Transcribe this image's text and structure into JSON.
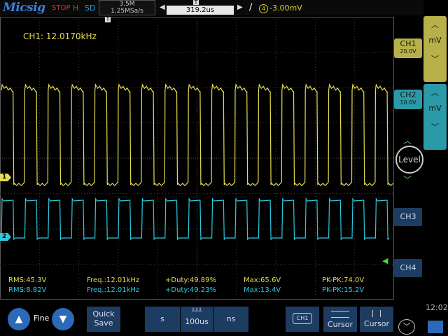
{
  "topbar": {
    "logo": "Micsig",
    "state": "STOP",
    "mode": "H",
    "sd": "SD",
    "memory": "3.5M",
    "sample_rate": "1.25MSa/s",
    "timebase_offset": "319.2us",
    "trigger_channel": "4",
    "trigger_level": "-3.00mV"
  },
  "screen": {
    "frequency_readout": "CH1: 12.0170kHz",
    "ch1_marker": "1",
    "ch2_marker": "2",
    "trigger_pos_marker": "T"
  },
  "measurements": {
    "ch1": {
      "rms": "RMS:45.3V",
      "freq": "Freq.:12.01kHz",
      "duty": "+Duty:49.89%",
      "max": "Max:65.6V",
      "pkpk": "PK-PK:74.0V"
    },
    "ch2": {
      "rms": "RMS:8.82V",
      "freq": "Freq.:12.01kHz",
      "duty": "+Duty:49.23%",
      "max": "Max:13.4V",
      "pkpk": "PK-PK:15.2V"
    }
  },
  "channels": {
    "ch1": {
      "label": "CH1",
      "scale": "20.0V"
    },
    "ch2": {
      "label": "CH2",
      "scale": "10.0V"
    },
    "ch3": {
      "label": "CH3"
    },
    "ch4": {
      "label": "CH4"
    }
  },
  "right_panel": {
    "unit1": "mV",
    "unit2": "mV",
    "level_label": "Level"
  },
  "bottombar": {
    "fine_label": "Fine",
    "quick_save_line1": "Quick",
    "quick_save_line2": "Save",
    "time_unit_s": "s",
    "time_value": "100us",
    "time_unit_ns": "ns",
    "ch_select": "CH1",
    "cursor1": "Cursor",
    "cursor2": "Cursor",
    "clock": "12:02"
  },
  "colors": {
    "ch1": "#e6dc50",
    "ch2": "#2fc8dc",
    "accent": "#2a6ab8"
  }
}
